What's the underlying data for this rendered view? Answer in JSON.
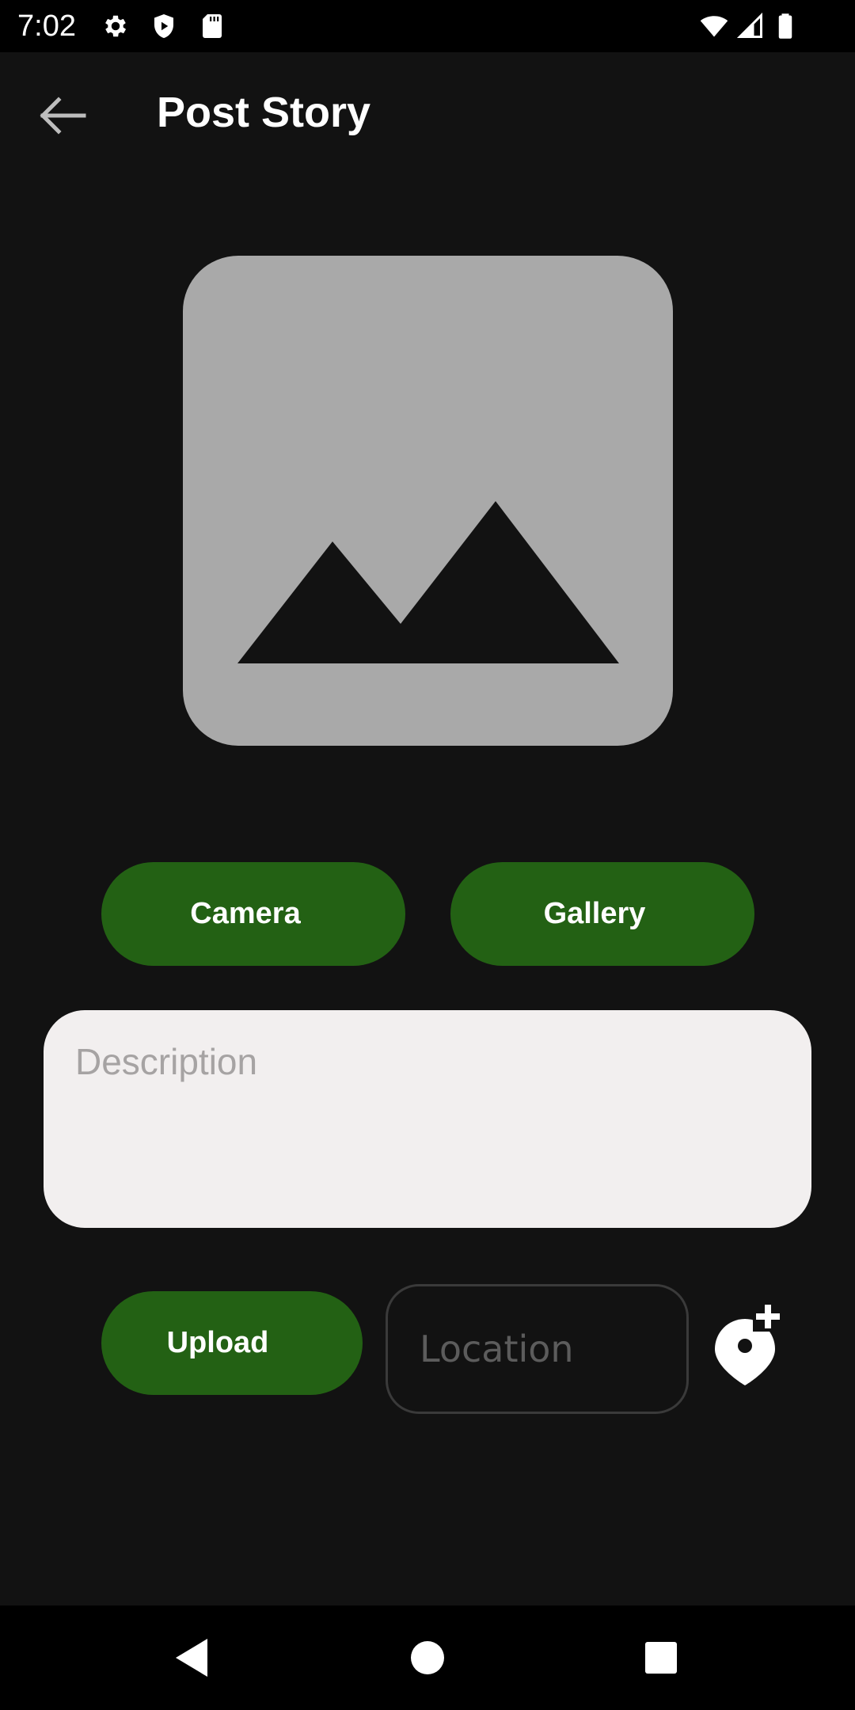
{
  "status_bar": {
    "time": "7:02",
    "left_icons": [
      "gear-icon",
      "shield-play-icon",
      "sd-card-icon"
    ],
    "right_icons": [
      "wifi-icon",
      "cell-signal-icon",
      "battery-icon"
    ]
  },
  "app_bar": {
    "title": "Post Story",
    "back_icon": "arrow-left-icon"
  },
  "image_preview": {
    "icon": "image-placeholder-icon"
  },
  "buttons": {
    "camera_label": "Camera",
    "gallery_label": "Gallery",
    "upload_label": "Upload"
  },
  "description": {
    "value": "",
    "placeholder": "Description"
  },
  "location": {
    "value": "",
    "placeholder": "Location",
    "add_icon": "add-location-icon"
  },
  "nav_bar": {
    "icons": [
      "nav-back-icon",
      "nav-home-icon",
      "nav-recents-icon"
    ]
  },
  "colors": {
    "background": "#121212",
    "accent_green": "#236114",
    "placeholder_gray": "#a9a9a9",
    "field_background": "#f2efef"
  }
}
